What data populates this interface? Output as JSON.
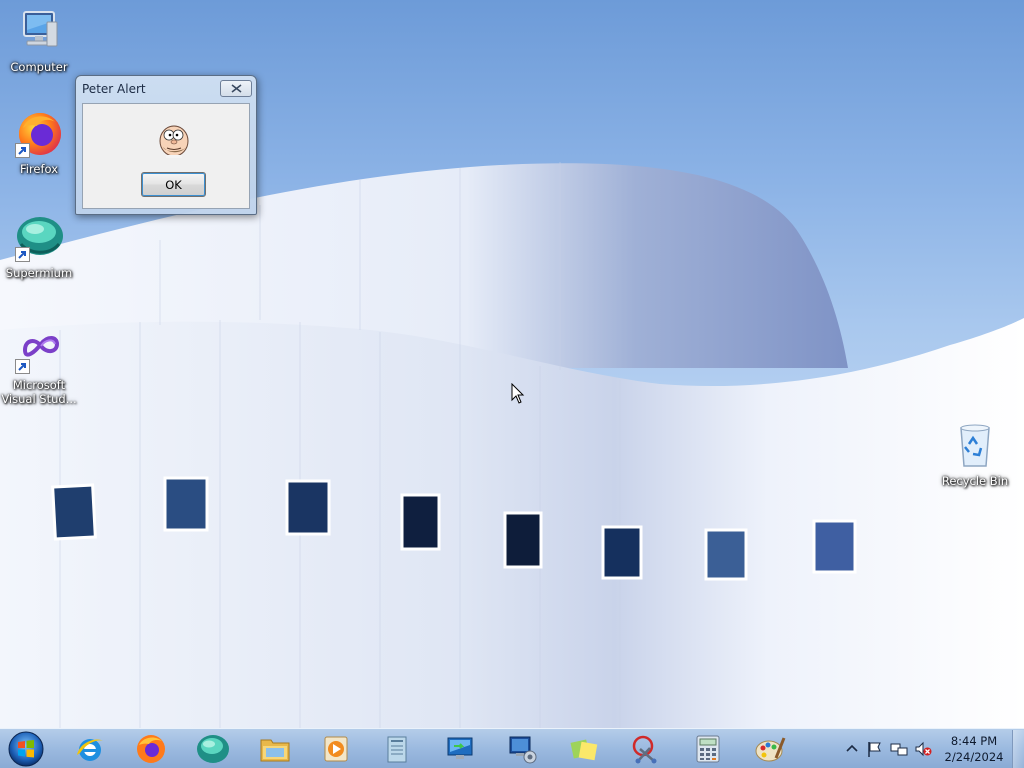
{
  "desktop": {
    "icons": [
      {
        "label": "Computer",
        "icon": "computer-icon"
      },
      {
        "label": "Firefox",
        "icon": "firefox-icon"
      },
      {
        "label": "Supermium",
        "icon": "supermium-icon"
      },
      {
        "label": "Microsoft Visual Stud...",
        "icon": "visual-studio-icon"
      },
      {
        "label": "Recycle Bin",
        "icon": "recycle-bin-icon"
      }
    ]
  },
  "dialog": {
    "title": "Peter Alert",
    "ok_label": "OK",
    "image": "peter-face-icon"
  },
  "taskbar": {
    "start": "windows-start-orb",
    "pinned": [
      "internet-explorer-icon",
      "firefox-icon",
      "supermium-icon",
      "file-explorer-icon",
      "media-player-icon",
      "notepad-icon",
      "remote-desktop-icon",
      "network-computer-icon",
      "sticky-notes-icon",
      "snipping-tool-icon",
      "calculator-icon",
      "paint-icon"
    ],
    "tray": {
      "icons": [
        "show-hidden-icons-arrow",
        "action-center-flag-icon",
        "network-icon",
        "volume-muted-icon"
      ],
      "time": "8:44 PM",
      "date": "2/24/2024"
    }
  },
  "colors": {
    "sky": "#7ea8e0",
    "building": "#eef2fa",
    "taskbar": "#9ab8e0"
  }
}
